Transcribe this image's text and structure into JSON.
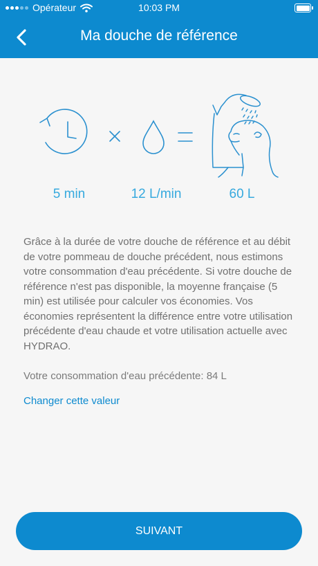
{
  "status_bar": {
    "carrier": "Opérateur",
    "time": "10:03 PM"
  },
  "header": {
    "title": "Ma douche de référence",
    "back_icon": "chevron-left-icon"
  },
  "equation": {
    "duration": "5 min",
    "flow": "12 L/min",
    "total": "60 L",
    "icons": [
      "clock-icon",
      "multiply-icon",
      "water-drop-icon",
      "equals-icon",
      "shower-person-icon"
    ]
  },
  "description": "Grâce à la durée de votre douche de référence et au débit de votre pommeau de douche précédent, nous estimons votre consommation d'eau précédente. Si votre douche de référence n'est pas disponible, la moyenne française (5 min) est utilisée pour calculer vos économies. Vos économies représentent la différence entre votre utilisation précédente d'eau chaude et votre utilisation actuelle avec HYDRAO.",
  "consumption_text": "Votre consommation d'eau précédente: 84 L",
  "change_link": "Changer cette valeur",
  "next_button": "SUIVANT",
  "colors": {
    "primary": "#0d8acf",
    "accent": "#36a9de",
    "text": "#707070"
  }
}
